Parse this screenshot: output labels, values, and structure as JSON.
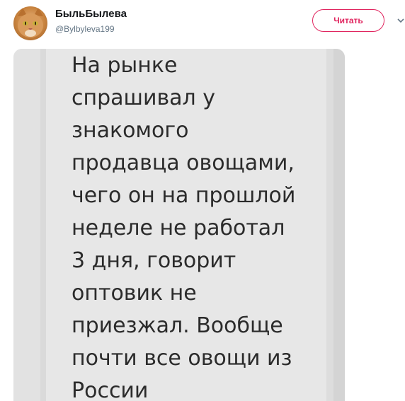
{
  "author": {
    "display_name": "БыльБылева",
    "handle": "@Bylbyleva199"
  },
  "actions": {
    "follow_label": "Читать"
  },
  "icons": {
    "avatar": "cat-avatar",
    "menu": "chevron-down-icon"
  },
  "media": {
    "message_text": "На рынке\nспрашивал у\nзнакомого\nпродавца овощами,\nчего он на прошлой\nнеделе не работал\n3 дня, говорит\nоптовик не\nприезжал. Вообще\nпочти все овощи из\nРоссии"
  },
  "colors": {
    "accent": "#e0245e",
    "name": "#14171a",
    "handle": "#657786",
    "media_background": "#e7e7e7",
    "message_text": "#2b2b2b"
  }
}
